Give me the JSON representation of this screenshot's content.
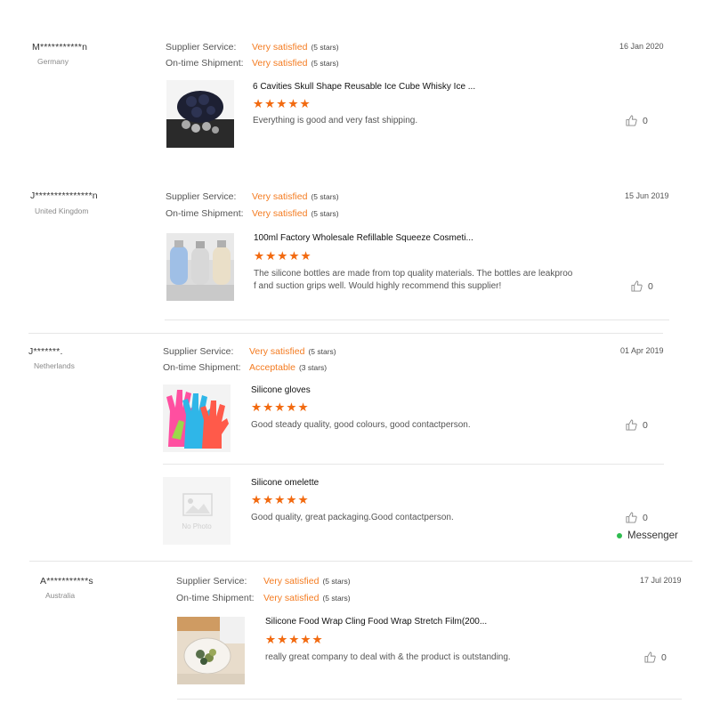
{
  "labels": {
    "supplier_service": "Supplier Service:",
    "on_time_shipment": "On-time Shipment:",
    "no_photo": "No Photo"
  },
  "messenger": {
    "label": "Messenger"
  },
  "colors": {
    "accent": "#f47b20",
    "star": "#f26a10",
    "online": "#2ebc4f"
  },
  "reviews": [
    {
      "user": "M***********n",
      "country": "Germany",
      "date": "16 Jan 2020",
      "supplier_service": {
        "value": "Very satisfied",
        "stars": "(5 stars)"
      },
      "on_time_shipment": {
        "value": "Very satisfied",
        "stars": "(5 stars)"
      },
      "products": [
        {
          "name": "6 Cavities Skull Shape Reusable Ice Cube Whisky Ice ...",
          "rating": 5,
          "comment": "Everything is good and very fast shipping.",
          "likes": "0",
          "thumb": "skull-ice-tray-photo"
        }
      ]
    },
    {
      "user": "J***************n",
      "country": "United Kingdom",
      "date": "15 Jun 2019",
      "supplier_service": {
        "value": "Very satisfied",
        "stars": "(5 stars)"
      },
      "on_time_shipment": {
        "value": "Very satisfied",
        "stars": "(5 stars)"
      },
      "products": [
        {
          "name": "100ml Factory Wholesale Refillable Squeeze Cosmeti...",
          "rating": 5,
          "comment_line1": "The silicone bottles are made from top quality materials. The bottles are leakproo",
          "comment_line2": "f and suction grips well. Would highly recommend this supplier!",
          "likes": "0",
          "thumb": "silicone-bottles-photo"
        }
      ]
    },
    {
      "user": "J*******.",
      "country": "Netherlands",
      "date": "01 Apr 2019",
      "supplier_service": {
        "value": "Very satisfied",
        "stars": "(5 stars)"
      },
      "on_time_shipment": {
        "value": "Acceptable",
        "stars": "(3 stars)"
      },
      "products": [
        {
          "name": "Silicone gloves",
          "rating": 5,
          "comment": "Good steady quality, good colours, good contactperson.",
          "likes": "0",
          "thumb": "silicone-gloves-photo"
        },
        {
          "name": "Silicone omelette",
          "rating": 5,
          "comment": "Good quality, great packaging.Good contactperson.",
          "likes": "0",
          "thumb": "no-photo-placeholder"
        }
      ]
    },
    {
      "user": "A***********s",
      "country": "Australia",
      "date": "17 Jul 2019",
      "supplier_service": {
        "value": "Very satisfied",
        "stars": "(5 stars)"
      },
      "on_time_shipment": {
        "value": "Very satisfied",
        "stars": "(5 stars)"
      },
      "products": [
        {
          "name": "Silicone Food Wrap Cling Food Wrap Stretch Film(200...",
          "rating": 5,
          "comment": "really great company to deal with & the product is outstanding.",
          "likes": "0",
          "thumb": "food-wrap-photo"
        }
      ]
    }
  ]
}
